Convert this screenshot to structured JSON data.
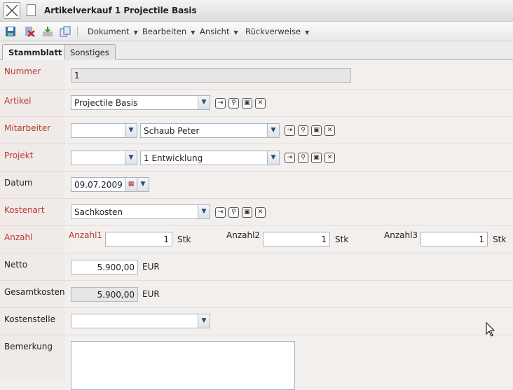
{
  "window": {
    "title": "Artikelverkauf 1 Projectile Basis"
  },
  "toolbar": {
    "menus": [
      "Dokument",
      "Bearbeiten",
      "Ansicht",
      "Rückverweise"
    ]
  },
  "tabs": [
    "Stammblatt",
    "Sonstiges"
  ],
  "form": {
    "nummer": {
      "label": "Nummer",
      "value": "1"
    },
    "artikel": {
      "label": "Artikel",
      "value": "Projectile Basis"
    },
    "mitarbeiter": {
      "label": "Mitarbeiter",
      "code": "",
      "value": "Schaub Peter"
    },
    "projekt": {
      "label": "Projekt",
      "code": "",
      "value": "1 Entwicklung"
    },
    "datum": {
      "label": "Datum",
      "value": "09.07.2009"
    },
    "kostenart": {
      "label": "Kostenart",
      "value": "Sachkosten"
    },
    "anzahl": {
      "label": "Anzahl",
      "a1_label": "Anzahl1",
      "a1": "1",
      "a2_label": "Anzahl2",
      "a2": "1",
      "a3_label": "Anzahl3",
      "a3": "1",
      "unit": "Stk"
    },
    "netto": {
      "label": "Netto",
      "value": "5.900,00",
      "unit": "EUR"
    },
    "gesamtkosten": {
      "label": "Gesamtkosten",
      "value": "5.900,00",
      "unit": "EUR"
    },
    "kostenstelle": {
      "label": "Kostenstelle",
      "value": ""
    },
    "bemerkung": {
      "label": "Bemerkung",
      "value": ""
    }
  }
}
